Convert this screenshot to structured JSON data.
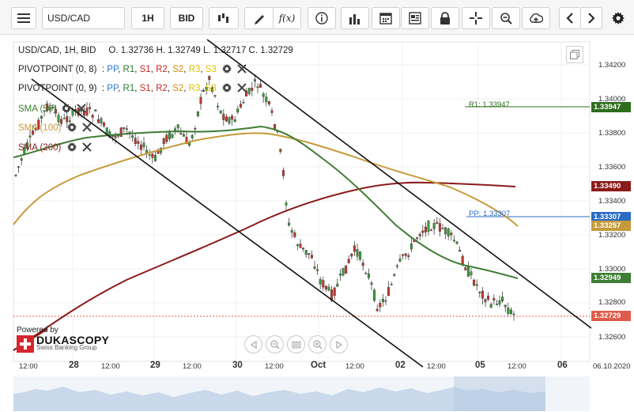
{
  "toolbar": {
    "menu_icon": "hamburger-menu-icon",
    "symbol": "USD/CAD",
    "timeframe": "1H",
    "price_side": "BID",
    "tools": [
      "candle-type-icon",
      "pencil-icon",
      "function-icon",
      "info-icon",
      "bar-chart-icon",
      "calendar-icon",
      "news-icon",
      "lock-icon",
      "crosshair-icon",
      "zoom-icon",
      "cloud-upload-icon",
      "arrow-left-icon",
      "arrow-right-icon",
      "gear-icon"
    ],
    "function_label": "f(x)"
  },
  "ohlc": {
    "header": "USD/CAD, 1H, BID",
    "open": "O. 1.32736",
    "high": "H. 1.32749",
    "low": "L. 1.32717",
    "close": "C. 1.32729"
  },
  "pivots": [
    {
      "label": "PIVOTPOINT (0, 8)",
      "levels": ": PP, R1, S1, R2, S2, R3, S3"
    },
    {
      "label": "PIVOTPOINT (0, 9)",
      "levels": ": PP, R1, S1, R2, S2, R3, S3"
    }
  ],
  "pivot_level_names": [
    "PP",
    "R1",
    "S1",
    "R2",
    "S2",
    "R3",
    "S3"
  ],
  "sma": [
    {
      "label": "SMA (50)",
      "color": "#3f7d34"
    },
    {
      "label": "SMA (100)",
      "color": "#c79a3a"
    },
    {
      "label": "SMA (200)",
      "color": "#8b1a1a"
    }
  ],
  "price_axis": {
    "ticks": [
      "1.34200",
      "1.34000",
      "1.33800",
      "1.33600",
      "1.33400",
      "1.33200",
      "1.33000",
      "1.32800",
      "1.32600"
    ],
    "tags": [
      {
        "value": "1.33947",
        "color": "#2e6e1e"
      },
      {
        "value": "1.33490",
        "color": "#8b1a1a"
      },
      {
        "value": "1.33307",
        "color": "#2b6cc4"
      },
      {
        "value": "1.33257",
        "color": "#c79a3a"
      },
      {
        "value": "1.32949",
        "color": "#3f7d34"
      },
      {
        "value": "1.32729",
        "color": "#e05a4a"
      }
    ]
  },
  "line_labels": {
    "r1": "R1: 1.33947",
    "pp": "PP: 1.33307"
  },
  "time_axis": {
    "labels": [
      "12:00",
      "28",
      "12:00",
      "29",
      "12:00",
      "30",
      "12:00",
      "Oct",
      "12:00",
      "02",
      "12:00",
      "05",
      "12:00",
      "06"
    ],
    "date": "06.10.2020"
  },
  "branding": {
    "powered_by": "Powered by",
    "name": "DUKASCOPY",
    "sub": "Swiss Banking Group"
  },
  "chart_data": {
    "type": "candlestick",
    "symbol": "USD/CAD",
    "timeframe": "1H",
    "ylim": [
      1.3255,
      1.343
    ],
    "last_close": 1.32729,
    "levels": {
      "R1": 1.33947,
      "PP": 1.33307
    },
    "sma_last": {
      "SMA (50)": 1.32949,
      "SMA (100)": 1.33257,
      "SMA (200)": 1.3349
    }
  }
}
